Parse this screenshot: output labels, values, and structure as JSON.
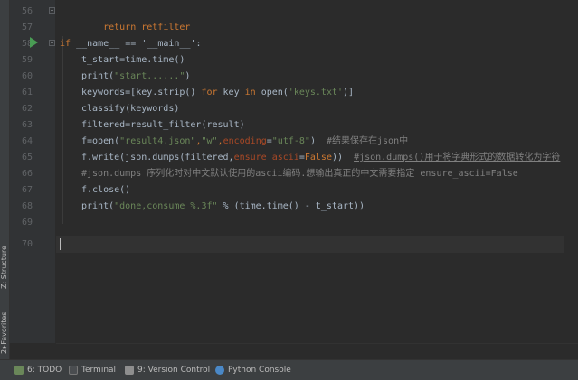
{
  "side_tabs": {
    "structure": "Z: Structure",
    "favorites": "2: Favorites"
  },
  "line_numbers": [
    "56",
    "57",
    "58",
    "59",
    "60",
    "61",
    "62",
    "63",
    "64",
    "65",
    "66",
    "67",
    "68",
    "69",
    "70"
  ],
  "code": {
    "l56": "return retfilter",
    "l58_if": "if",
    "l58_rest": " __name__ == '__main__':",
    "l59": "t_start=time.time()",
    "l60_a": "print(",
    "l60_s": "\"start......\"",
    "l60_b": ")",
    "l61_a": "keywords=[key.strip() ",
    "l61_for": "for",
    "l61_b": " key ",
    "l61_in": "in",
    "l61_c": " open(",
    "l61_s": "'keys.txt'",
    "l61_d": ")]",
    "l62": "classify(keywords)",
    "l63": "filtered=result_filter(result)",
    "l64_a": "f=open(",
    "l64_s1": "\"result4.json\"",
    "l64_b": ",",
    "l64_s2": "\"w\"",
    "l64_c": ",",
    "l64_p": "encoding",
    "l64_d": "=",
    "l64_s3": "\"utf-8\"",
    "l64_e": ")  ",
    "l64_cmt": "#结果保存在json中",
    "l65_a": "f.write(json.dumps(filtered,",
    "l65_p": "ensure_ascii",
    "l65_b": "=",
    "l65_k": "False",
    "l65_c": "))  ",
    "l65_cmt": "#json.dumps()用于将字典形式的数据转化为字符",
    "l66_cmt": "#json.dumps 序列化时对中文默认使用的ascii编码.想输出真正的中文需要指定 ensure_ascii=False",
    "l67": "f.close()",
    "l68_a": "print(",
    "l68_s": "\"done,consume %.3f\"",
    "l68_b": " % (time.time() - t_start))"
  },
  "bottom_tabs": [
    {
      "label": "6: TODO",
      "icon": "todo-icon"
    },
    {
      "label": "Terminal",
      "icon": "terminal-icon"
    },
    {
      "label": "9: Version Control",
      "icon": "version-control-icon"
    },
    {
      "label": "Python Console",
      "icon": "python-console-icon"
    }
  ],
  "colors": {
    "background": "#2b2b2b",
    "keyword": "#cc7832",
    "string": "#6a8759",
    "comment": "#808080",
    "run_arrow": "#499c54"
  }
}
